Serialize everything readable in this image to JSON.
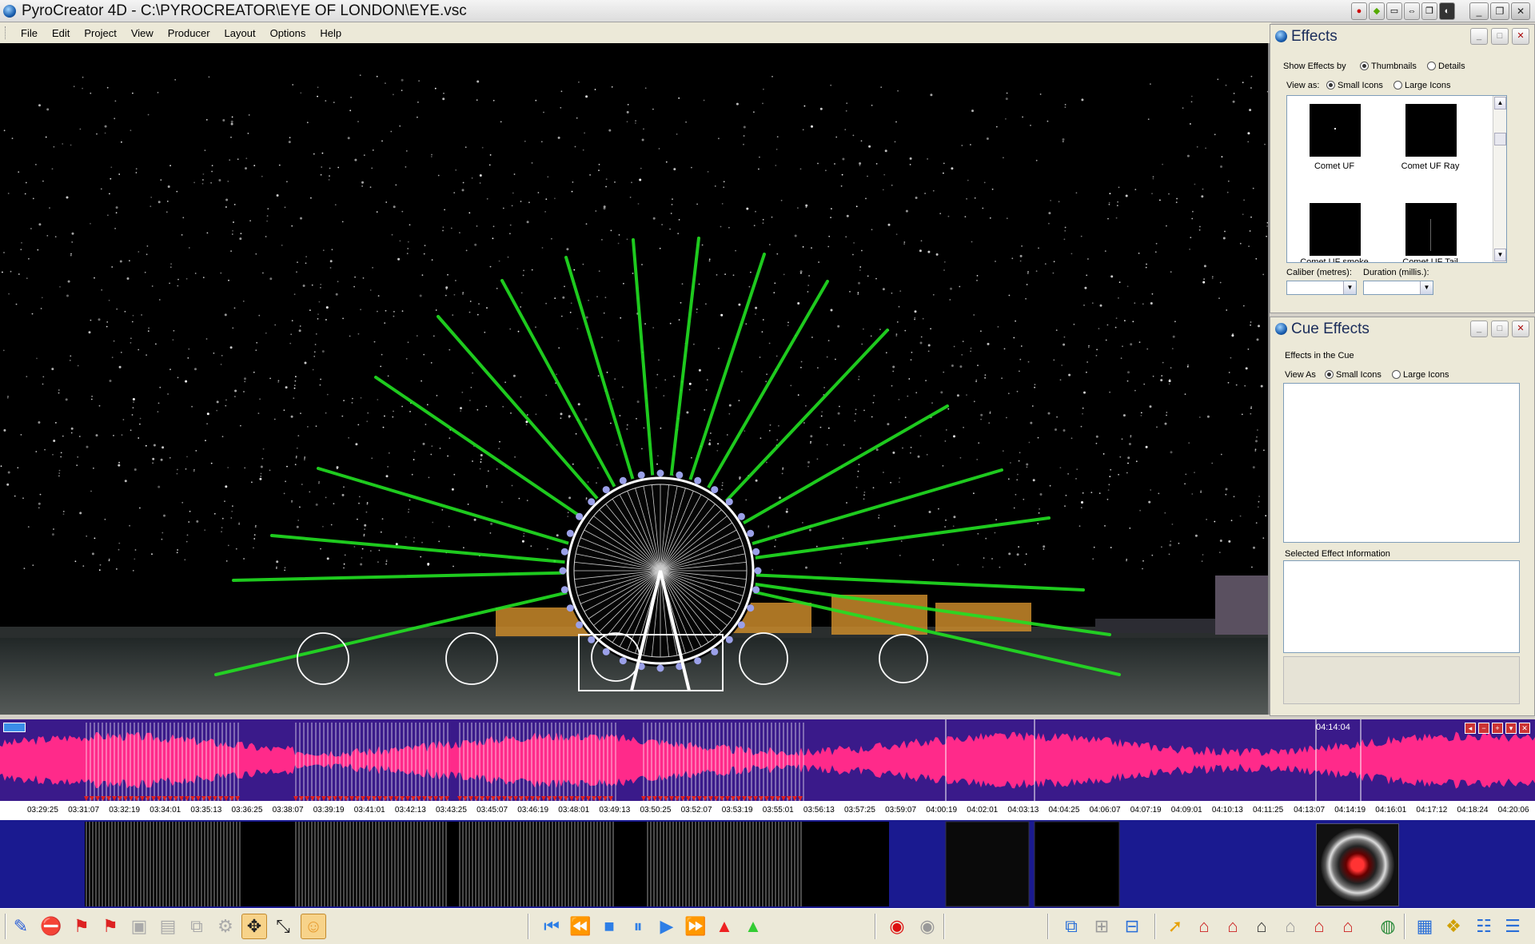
{
  "window": {
    "title": "PyroCreator 4D - C:\\PYROCREATOR\\EYE OF LONDON\\EYE.vsc"
  },
  "menu": [
    "File",
    "Edit",
    "Project",
    "View",
    "Producer",
    "Layout",
    "Options",
    "Help"
  ],
  "effects_panel": {
    "title": "Effects",
    "show_by_label": "Show Effects by",
    "show_by_options": [
      "Thumbnails",
      "Details"
    ],
    "show_by_selected": "Thumbnails",
    "view_as_label": "View as:",
    "view_as_options": [
      "Small Icons",
      "Large Icons"
    ],
    "view_as_selected": "Small Icons",
    "thumbnails": [
      {
        "label": "Comet UF"
      },
      {
        "label": "Comet UF Ray"
      },
      {
        "label": "Comet UF smoke"
      },
      {
        "label": "Comet UF Tail"
      }
    ],
    "caliber_label": "Caliber (metres):",
    "duration_label": "Duration (millis.):"
  },
  "cue_panel": {
    "title": "Cue Effects",
    "effects_in_cue_label": "Effects in the Cue",
    "view_as_label": "View As",
    "view_as_options": [
      "Small Icons",
      "Large Icons"
    ],
    "view_as_selected": "Small Icons",
    "selected_info_label": "Selected Effect Information"
  },
  "timeline": {
    "cursor_time": "04:14:04",
    "ticks": [
      "03:29:25",
      "03:31:07",
      "03:32:19",
      "03:34:01",
      "03:35:13",
      "03:36:25",
      "03:38:07",
      "03:39:19",
      "03:41:01",
      "03:42:13",
      "03:43:25",
      "03:45:07",
      "03:46:19",
      "03:48:01",
      "03:49:13",
      "03:50:25",
      "03:52:07",
      "03:53:19",
      "03:55:01",
      "03:56:13",
      "03:57:25",
      "03:59:07",
      "04:00:19",
      "04:02:01",
      "04:03:13",
      "04:04:25",
      "04:06:07",
      "04:07:19",
      "04:09:01",
      "04:10:13",
      "04:11:25",
      "04:13:07",
      "04:14:19",
      "04:16:01",
      "04:17:12",
      "04:18:24",
      "04:20:06"
    ]
  },
  "colors": {
    "waveform": "#ff2a8a",
    "timeline_bg": "#3a1a8a",
    "laser": "#22e022",
    "panel_bg": "#ece9d8"
  },
  "toolbar_icons": [
    "edit-icon",
    "delete-icon",
    "flag-red-icon",
    "flag-text-icon",
    "group-icon",
    "ungroup-icon",
    "copy-icon",
    "gear-icon",
    "move-icon",
    "scale-icon",
    "person-icon",
    "skip-start-icon",
    "rewind-icon",
    "stop-icon",
    "pause-icon",
    "play-icon",
    "fast-forward-icon",
    "warning-red-icon",
    "triangle-green-icon",
    "record-icon",
    "record-disabled-icon",
    "network-icon",
    "hierarchy-icon",
    "tree-icon",
    "cursor-icon",
    "house-icon",
    "house-add-icon",
    "house-tools-icon",
    "house-gray-icon",
    "house-plus-icon",
    "house-red-icon",
    "globe-icon",
    "picture-icon",
    "palette-icon",
    "people-icon",
    "list-icon"
  ]
}
